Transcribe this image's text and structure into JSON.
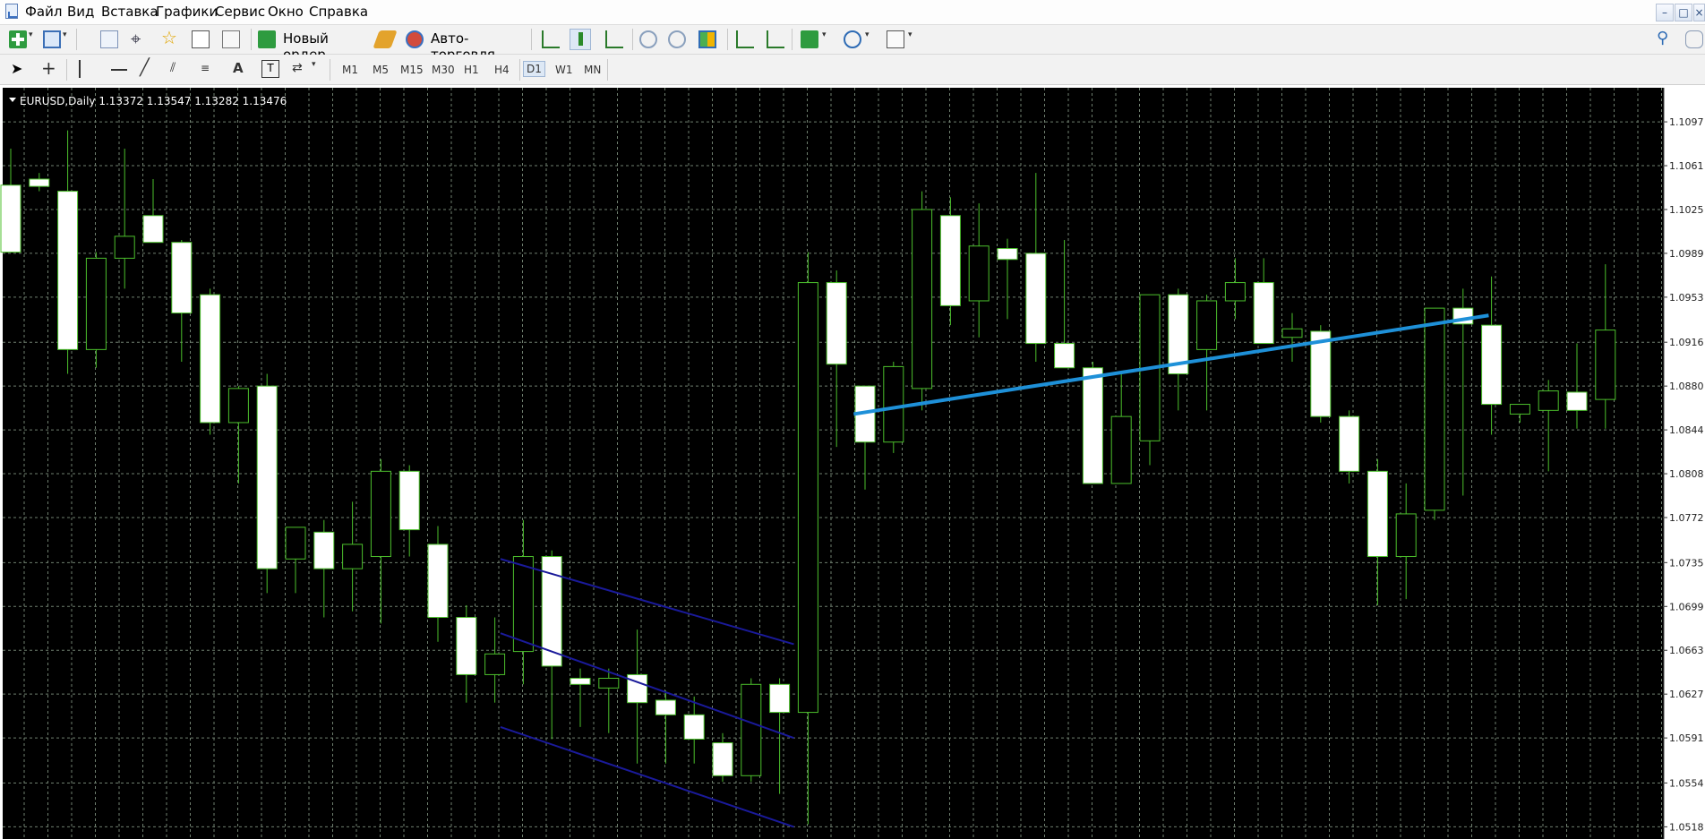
{
  "menu": {
    "items": [
      "Файл",
      "Вид",
      "Вставка",
      "Графики",
      "Сервис",
      "Окно",
      "Справка"
    ],
    "window_buttons": [
      "–",
      "□",
      "×"
    ]
  },
  "toolbar": {
    "new_order": "Новый ордер",
    "auto_trading": "Авто-торговля"
  },
  "timeframes": [
    "M1",
    "M5",
    "M15",
    "M30",
    "H1",
    "H4",
    "D1",
    "W1",
    "MN"
  ],
  "active_timeframe": "D1",
  "colors": {
    "chart_bg": "#000000",
    "grid": "#6f7f6f",
    "candle_border": "#4cbf2c",
    "bull_body": "#000000",
    "bear_body": "#ffffff",
    "trendline": "#1e90d8",
    "channel": "#1a1a9a"
  },
  "chart_data": {
    "type": "candlestick",
    "header": "EURUSD,Daily  1.13372 1.13547 1.13282 1.13476",
    "y_ticks": [
      "1.1097",
      "1.1061",
      "1.1025",
      "1.0989",
      "1.0953",
      "1.0916",
      "1.0880",
      "1.0844",
      "1.0808",
      "1.0772",
      "1.0735",
      "1.0699",
      "1.0663",
      "1.0627",
      "1.0591",
      "1.0554",
      "1.0518"
    ],
    "ylim": [
      1.0508,
      1.1125
    ],
    "candles": [
      {
        "o": 1.1045,
        "h": 1.1075,
        "l": 1.0995,
        "c": 1.099
      },
      {
        "o": 1.105,
        "h": 1.1055,
        "l": 1.104,
        "c": 1.1044
      },
      {
        "o": 1.104,
        "h": 1.109,
        "l": 1.089,
        "c": 1.091
      },
      {
        "o": 1.091,
        "h": 1.099,
        "l": 1.0895,
        "c": 1.0985
      },
      {
        "o": 1.0985,
        "h": 1.1075,
        "l": 1.096,
        "c": 1.1003
      },
      {
        "o": 1.102,
        "h": 1.105,
        "l": 1.1,
        "c": 1.0998
      },
      {
        "o": 1.0998,
        "h": 1.1,
        "l": 1.09,
        "c": 1.094
      },
      {
        "o": 1.0955,
        "h": 1.096,
        "l": 1.084,
        "c": 1.085
      },
      {
        "o": 1.085,
        "h": 1.088,
        "l": 1.08,
        "c": 1.0878
      },
      {
        "o": 1.088,
        "h": 1.089,
        "l": 1.071,
        "c": 1.073
      },
      {
        "o": 1.0738,
        "h": 1.076,
        "l": 1.071,
        "c": 1.0764
      },
      {
        "o": 1.076,
        "h": 1.077,
        "l": 1.069,
        "c": 1.073
      },
      {
        "o": 1.073,
        "h": 1.0785,
        "l": 1.0695,
        "c": 1.075
      },
      {
        "o": 1.074,
        "h": 1.082,
        "l": 1.0685,
        "c": 1.081
      },
      {
        "o": 1.081,
        "h": 1.0815,
        "l": 1.074,
        "c": 1.0762
      },
      {
        "o": 1.075,
        "h": 1.0765,
        "l": 1.067,
        "c": 1.069
      },
      {
        "o": 1.069,
        "h": 1.07,
        "l": 1.062,
        "c": 1.0643
      },
      {
        "o": 1.0643,
        "h": 1.069,
        "l": 1.062,
        "c": 1.066
      },
      {
        "o": 1.0662,
        "h": 1.077,
        "l": 1.0635,
        "c": 1.074
      },
      {
        "o": 1.074,
        "h": 1.0745,
        "l": 1.059,
        "c": 1.065
      },
      {
        "o": 1.064,
        "h": 1.0648,
        "l": 1.06,
        "c": 1.0635
      },
      {
        "o": 1.0632,
        "h": 1.0648,
        "l": 1.0595,
        "c": 1.064
      },
      {
        "o": 1.0643,
        "h": 1.068,
        "l": 1.057,
        "c": 1.062
      },
      {
        "o": 1.0622,
        "h": 1.063,
        "l": 1.057,
        "c": 1.061
      },
      {
        "o": 1.061,
        "h": 1.0625,
        "l": 1.057,
        "c": 1.059
      },
      {
        "o": 1.0587,
        "h": 1.0595,
        "l": 1.0555,
        "c": 1.056
      },
      {
        "o": 1.056,
        "h": 1.064,
        "l": 1.0555,
        "c": 1.0635
      },
      {
        "o": 1.0635,
        "h": 1.064,
        "l": 1.0545,
        "c": 1.0612
      },
      {
        "o": 1.0612,
        "h": 1.099,
        "l": 1.052,
        "c": 1.0965
      },
      {
        "o": 1.0965,
        "h": 1.0975,
        "l": 1.083,
        "c": 1.0898
      },
      {
        "o": 1.088,
        "h": 1.0875,
        "l": 1.0795,
        "c": 1.0834
      },
      {
        "o": 1.0834,
        "h": 1.09,
        "l": 1.0825,
        "c": 1.0896
      },
      {
        "o": 1.0878,
        "h": 1.104,
        "l": 1.086,
        "c": 1.1025
      },
      {
        "o": 1.102,
        "h": 1.1035,
        "l": 1.093,
        "c": 1.0946
      },
      {
        "o": 1.095,
        "h": 1.103,
        "l": 1.092,
        "c": 1.0995
      },
      {
        "o": 1.0993,
        "h": 1.1001,
        "l": 1.0935,
        "c": 1.0984
      },
      {
        "o": 1.0989,
        "h": 1.1055,
        "l": 1.09,
        "c": 1.0915
      },
      {
        "o": 1.0915,
        "h": 1.1,
        "l": 1.09,
        "c": 1.0895
      },
      {
        "o": 1.0895,
        "h": 1.09,
        "l": 1.08,
        "c": 1.08
      },
      {
        "o": 1.08,
        "h": 1.089,
        "l": 1.08,
        "c": 1.0855
      },
      {
        "o": 1.0835,
        "h": 1.092,
        "l": 1.0815,
        "c": 1.0955
      },
      {
        "o": 1.0955,
        "h": 1.096,
        "l": 1.086,
        "c": 1.089
      },
      {
        "o": 1.091,
        "h": 1.0955,
        "l": 1.086,
        "c": 1.095
      },
      {
        "o": 1.095,
        "h": 1.0985,
        "l": 1.0935,
        "c": 1.0965
      },
      {
        "o": 1.0965,
        "h": 1.0985,
        "l": 1.0918,
        "c": 1.0915
      },
      {
        "o": 1.092,
        "h": 1.094,
        "l": 1.09,
        "c": 1.0927
      },
      {
        "o": 1.0925,
        "h": 1.093,
        "l": 1.085,
        "c": 1.0855
      },
      {
        "o": 1.0855,
        "h": 1.086,
        "l": 1.08,
        "c": 1.081
      },
      {
        "o": 1.081,
        "h": 1.082,
        "l": 1.07,
        "c": 1.074
      },
      {
        "o": 1.074,
        "h": 1.08,
        "l": 1.0705,
        "c": 1.0775
      },
      {
        "o": 1.0778,
        "h": 1.094,
        "l": 1.077,
        "c": 1.0944
      },
      {
        "o": 1.0944,
        "h": 1.096,
        "l": 1.079,
        "c": 1.0931
      },
      {
        "o": 1.093,
        "h": 1.097,
        "l": 1.084,
        "c": 1.0865
      },
      {
        "o": 1.0857,
        "h": 1.0865,
        "l": 1.085,
        "c": 1.0865
      },
      {
        "o": 1.086,
        "h": 1.0885,
        "l": 1.081,
        "c": 1.0876
      },
      {
        "o": 1.0875,
        "h": 1.0915,
        "l": 1.0845,
        "c": 1.086
      },
      {
        "o": 1.0869,
        "h": 1.098,
        "l": 1.0845,
        "c": 1.0926
      }
    ]
  }
}
